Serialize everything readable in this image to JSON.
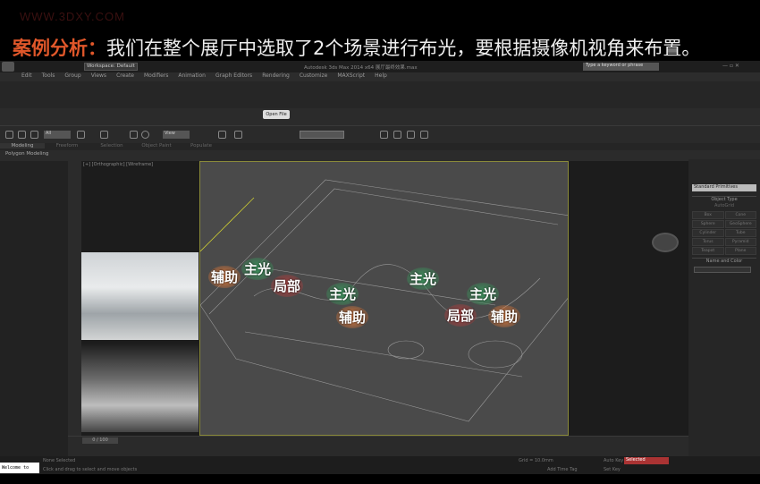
{
  "watermark": "WWW.3DXY.COM",
  "headline": {
    "lead": "案例分析：",
    "text": "我们在整个展厅中选取了2个场景进行布光，要根据摄像机视角来布置。"
  },
  "app": {
    "title": "Autodesk 3ds Max 2014 x64    展厅最终效果.max",
    "workspace": "Workspace: Default",
    "search_placeholder": "Type a keyword or phrase",
    "menus": [
      "Edit",
      "Tools",
      "Group",
      "Views",
      "Create",
      "Modifiers",
      "Animation",
      "Graph Editors",
      "Rendering",
      "Customize",
      "MAXScript",
      "Help"
    ],
    "open_file": "Open File",
    "tabs": [
      "Modeling",
      "Freeform",
      "Selection",
      "Object Paint",
      "Populate"
    ],
    "polygon_modeling": "Polygon Modeling",
    "viewport_label": "[+] [Orthographic] [Wireframe]",
    "selection_filter": "All",
    "view_dropdown": "View",
    "command_panel": {
      "dropdown": "Standard Primitives",
      "object_type": "Object Type",
      "autogrid": "AutoGrid",
      "buttons": [
        "Box",
        "Cone",
        "Sphere",
        "GeoSphere",
        "Cylinder",
        "Tube",
        "Torus",
        "Pyramid",
        "Teapot",
        "Plane"
      ],
      "name_color": "Name and Color"
    },
    "timeline": {
      "frame": "0 / 100"
    },
    "status": {
      "selection": "None Selected",
      "prompt": "Click and drag to select and move objects",
      "maxscript": "Welcome to MAX",
      "auto_key": "Auto Key",
      "set_key": "Set Key",
      "selected": "Selected",
      "add_time_tag": "Add Time Tag",
      "grid": "Grid = 10.0mm"
    }
  },
  "annotations": {
    "aux": "辅助",
    "main": "主光",
    "local": "局部"
  }
}
